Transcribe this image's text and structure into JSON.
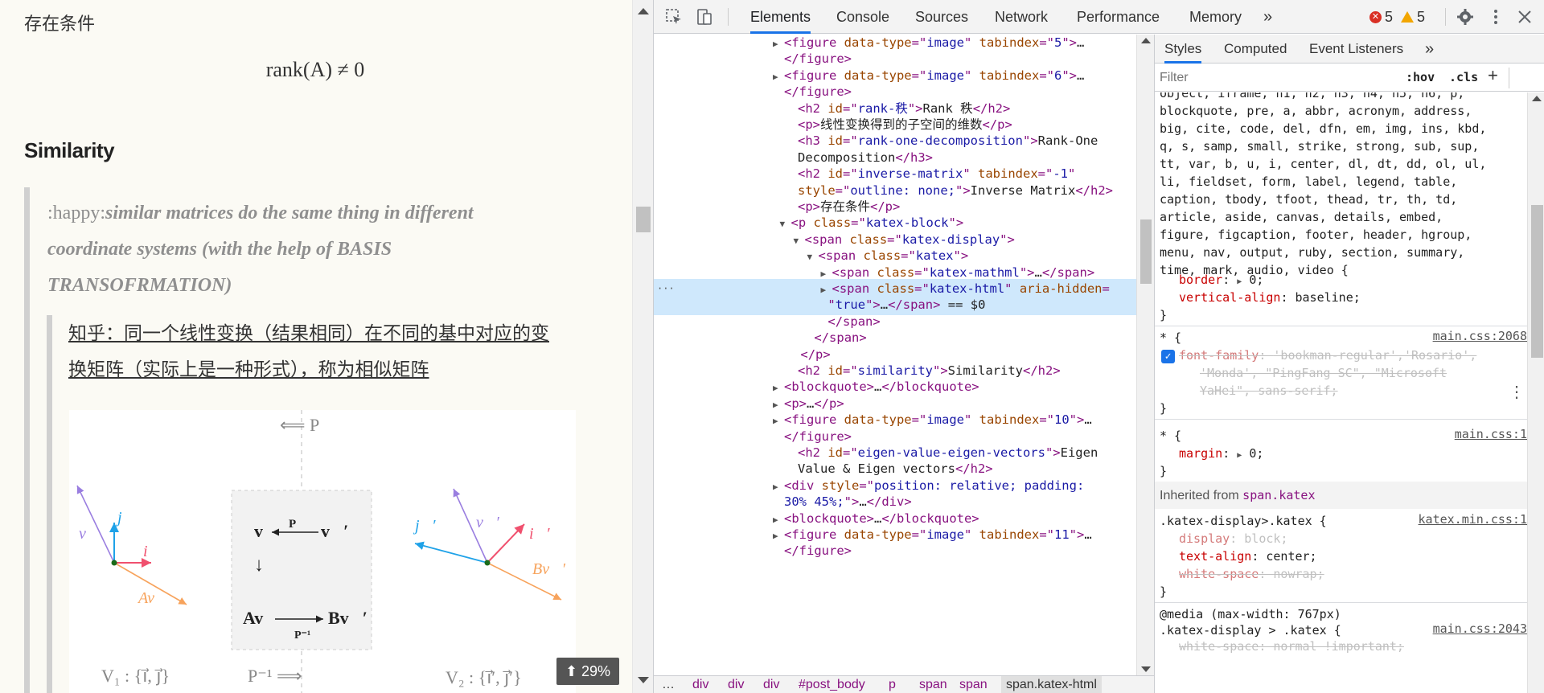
{
  "page": {
    "condition_label": "存在条件",
    "rank_formula": "rank(A) ≠ 0",
    "similarity_heading": "Similarity",
    "quote_prefix": ":happy:",
    "quote_text": "similar matrices do the same thing in different coordinate systems (with the help of BASIS TRANSOFRMATION)",
    "zhihu_quote": "知乎：同一个线性变换（结果相同）在不同的基中对应的变换矩阵（实际上是一种形式），称为相似矩阵",
    "scroll_percent": "29%",
    "figure": {
      "top_arrow": "⟸ P",
      "bottom_arrow": "P⁻¹ ⟹",
      "left_basis": "V₁ : {i⃗, j⃗}",
      "right_basis": "V₂ : {i⃗′, j⃗′}",
      "labels": {
        "v": "v⃗",
        "j": "j⃗",
        "i": "i⃗",
        "Av": "Av⃗",
        "jp": "j⃗′",
        "vp": "v⃗′",
        "ip": "i⃗′",
        "Bvp": "Bv⃗′",
        "box_v": "v⃗",
        "box_vp": "v⃗′",
        "box_P": "P",
        "box_Av": "Av⃗",
        "box_Bvp": "Bv⃗′",
        "box_Pinv": "P⁻¹",
        "box_down": "↓"
      },
      "colors": {
        "v": "#9a7ee0",
        "j": "#1fa2e8",
        "i": "#f0506e",
        "Av": "#f7a35c"
      }
    }
  },
  "devtools": {
    "tabs": [
      "Elements",
      "Console",
      "Sources",
      "Network",
      "Performance",
      "Memory"
    ],
    "more_tabs": "»",
    "errors": "5",
    "warnings": "5",
    "elements_lines": [
      {
        "indent": 0,
        "tri": "▶",
        "html": [
          [
            "tag",
            "<figure "
          ],
          [
            "attr",
            "data-type"
          ],
          [
            "tag",
            "=\""
          ],
          [
            "val",
            "image"
          ],
          [
            "tag",
            "\" "
          ],
          [
            "attr",
            "tabindex"
          ],
          [
            "tag",
            "=\""
          ],
          [
            "val",
            "5"
          ],
          [
            "tag",
            "\">"
          ],
          [
            "txt",
            "…"
          ]
        ]
      },
      {
        "indent": 0,
        "tri": "",
        "html": [
          [
            "tag",
            "</figure>"
          ]
        ]
      },
      {
        "indent": 0,
        "tri": "▶",
        "html": [
          [
            "tag",
            "<figure "
          ],
          [
            "attr",
            "data-type"
          ],
          [
            "tag",
            "=\""
          ],
          [
            "val",
            "image"
          ],
          [
            "tag",
            "\" "
          ],
          [
            "attr",
            "tabindex"
          ],
          [
            "tag",
            "=\""
          ],
          [
            "val",
            "6"
          ],
          [
            "tag",
            "\">"
          ],
          [
            "txt",
            "…"
          ]
        ]
      },
      {
        "indent": 0,
        "tri": "",
        "html": [
          [
            "tag",
            "</figure>"
          ]
        ]
      },
      {
        "indent": 1,
        "tri": "",
        "html": [
          [
            "tag",
            "<h2 "
          ],
          [
            "attr",
            "id"
          ],
          [
            "tag",
            "=\""
          ],
          [
            "val",
            "rank-秩"
          ],
          [
            "tag",
            "\">"
          ],
          [
            "txt",
            "Rank 秩"
          ],
          [
            "tag",
            "</h2>"
          ]
        ]
      },
      {
        "indent": 1,
        "tri": "",
        "html": [
          [
            "tag",
            "<p>"
          ],
          [
            "txt",
            "线性变换得到的子空间的维数"
          ],
          [
            "tag",
            "</p>"
          ]
        ]
      },
      {
        "indent": 1,
        "tri": "",
        "html": [
          [
            "tag",
            "<h3 "
          ],
          [
            "attr",
            "id"
          ],
          [
            "tag",
            "=\""
          ],
          [
            "val",
            "rank-one-decomposition"
          ],
          [
            "tag",
            "\">"
          ],
          [
            "txt",
            "Rank-One"
          ]
        ]
      },
      {
        "indent": 1,
        "tri": "",
        "html": [
          [
            "txt",
            "Decomposition"
          ],
          [
            "tag",
            "</h3>"
          ]
        ]
      },
      {
        "indent": 1,
        "tri": "",
        "html": [
          [
            "tag",
            "<h2 "
          ],
          [
            "attr",
            "id"
          ],
          [
            "tag",
            "=\""
          ],
          [
            "val",
            "inverse-matrix"
          ],
          [
            "tag",
            "\" "
          ],
          [
            "attr",
            "tabindex"
          ],
          [
            "tag",
            "=\""
          ],
          [
            "val",
            "-1"
          ],
          [
            "tag",
            "\""
          ]
        ]
      },
      {
        "indent": 1,
        "tri": "",
        "html": [
          [
            "attr",
            "style"
          ],
          [
            "tag",
            "=\""
          ],
          [
            "val",
            "outline: none;"
          ],
          [
            "tag",
            "\">"
          ],
          [
            "txt",
            "Inverse Matrix"
          ],
          [
            "tag",
            "</h2>"
          ]
        ]
      },
      {
        "indent": 1,
        "tri": "",
        "html": [
          [
            "tag",
            "<p>"
          ],
          [
            "txt",
            "存在条件"
          ],
          [
            "tag",
            "</p>"
          ]
        ]
      },
      {
        "indent": 0.5,
        "tri": "▼",
        "html": [
          [
            "tag",
            "<p "
          ],
          [
            "attr",
            "class"
          ],
          [
            "tag",
            "=\""
          ],
          [
            "val",
            "katex-block"
          ],
          [
            "tag",
            "\">"
          ]
        ]
      },
      {
        "indent": 1.5,
        "tri": "▼",
        "html": [
          [
            "tag",
            "<span "
          ],
          [
            "attr",
            "class"
          ],
          [
            "tag",
            "=\""
          ],
          [
            "val",
            "katex-display"
          ],
          [
            "tag",
            "\">"
          ]
        ]
      },
      {
        "indent": 2.5,
        "tri": "▼",
        "html": [
          [
            "tag",
            "<span "
          ],
          [
            "attr",
            "class"
          ],
          [
            "tag",
            "=\""
          ],
          [
            "val",
            "katex"
          ],
          [
            "tag",
            "\">"
          ]
        ]
      },
      {
        "indent": 3.5,
        "tri": "▶",
        "html": [
          [
            "tag",
            "<span "
          ],
          [
            "attr",
            "class"
          ],
          [
            "tag",
            "=\""
          ],
          [
            "val",
            "katex-mathml"
          ],
          [
            "tag",
            "\">"
          ],
          [
            "txt",
            "…"
          ],
          [
            "tag",
            "</span>"
          ]
        ]
      },
      {
        "indent": 3.5,
        "tri": "▶",
        "sel": true,
        "html": [
          [
            "tag",
            "<span "
          ],
          [
            "attr",
            "class"
          ],
          [
            "tag",
            "=\""
          ],
          [
            "val",
            "katex-html"
          ],
          [
            "tag",
            "\" "
          ],
          [
            "attr",
            "aria-hidden"
          ],
          [
            "tag",
            "="
          ]
        ]
      },
      {
        "indent": 3.2,
        "tri": "",
        "sel": true,
        "html": [
          [
            "tag",
            "\""
          ],
          [
            "val",
            "true"
          ],
          [
            "tag",
            "\">"
          ],
          [
            "txt",
            "…"
          ],
          [
            "tag",
            "</span>"
          ],
          [
            "txt",
            " == $0"
          ]
        ]
      },
      {
        "indent": 3.2,
        "tri": "",
        "html": [
          [
            "tag",
            "</span>"
          ]
        ]
      },
      {
        "indent": 2.2,
        "tri": "",
        "html": [
          [
            "tag",
            "</span>"
          ]
        ]
      },
      {
        "indent": 1.2,
        "tri": "",
        "html": [
          [
            "tag",
            "</p>"
          ]
        ]
      },
      {
        "indent": 1,
        "tri": "",
        "html": [
          [
            "tag",
            "<h2 "
          ],
          [
            "attr",
            "id"
          ],
          [
            "tag",
            "=\""
          ],
          [
            "val",
            "similarity"
          ],
          [
            "tag",
            "\">"
          ],
          [
            "txt",
            "Similarity"
          ],
          [
            "tag",
            "</h2>"
          ]
        ]
      },
      {
        "indent": 0,
        "tri": "▶",
        "html": [
          [
            "tag",
            "<blockquote>"
          ],
          [
            "txt",
            "…"
          ],
          [
            "tag",
            "</blockquote>"
          ]
        ]
      },
      {
        "indent": 0,
        "tri": "▶",
        "html": [
          [
            "tag",
            "<p>"
          ],
          [
            "txt",
            "…"
          ],
          [
            "tag",
            "</p>"
          ]
        ]
      },
      {
        "indent": 0,
        "tri": "▶",
        "html": [
          [
            "tag",
            "<figure "
          ],
          [
            "attr",
            "data-type"
          ],
          [
            "tag",
            "=\""
          ],
          [
            "val",
            "image"
          ],
          [
            "tag",
            "\" "
          ],
          [
            "attr",
            "tabindex"
          ],
          [
            "tag",
            "=\""
          ],
          [
            "val",
            "10"
          ],
          [
            "tag",
            "\">"
          ],
          [
            "txt",
            "…"
          ]
        ]
      },
      {
        "indent": 0,
        "tri": "",
        "html": [
          [
            "tag",
            "</figure>"
          ]
        ]
      },
      {
        "indent": 1,
        "tri": "",
        "html": [
          [
            "tag",
            "<h2 "
          ],
          [
            "attr",
            "id"
          ],
          [
            "tag",
            "=\""
          ],
          [
            "val",
            "eigen-value-eigen-vectors"
          ],
          [
            "tag",
            "\">"
          ],
          [
            "txt",
            "Eigen"
          ]
        ]
      },
      {
        "indent": 1,
        "tri": "",
        "html": [
          [
            "txt",
            "Value & Eigen vectors"
          ],
          [
            "tag",
            "</h2>"
          ]
        ]
      },
      {
        "indent": 0,
        "tri": "▶",
        "html": [
          [
            "tag",
            "<div "
          ],
          [
            "attr",
            "style"
          ],
          [
            "tag",
            "=\""
          ],
          [
            "val",
            "position: relative; padding:"
          ]
        ]
      },
      {
        "indent": 0,
        "tri": "",
        "html": [
          [
            "val",
            "30% 45%;"
          ],
          [
            "tag",
            "\">"
          ],
          [
            "txt",
            "…"
          ],
          [
            "tag",
            "</div>"
          ]
        ]
      },
      {
        "indent": 0,
        "tri": "▶",
        "html": [
          [
            "tag",
            "<blockquote>"
          ],
          [
            "txt",
            "…"
          ],
          [
            "tag",
            "</blockquote>"
          ]
        ]
      },
      {
        "indent": 0,
        "tri": "▶",
        "html": [
          [
            "tag",
            "<figure "
          ],
          [
            "attr",
            "data-type"
          ],
          [
            "tag",
            "=\""
          ],
          [
            "val",
            "image"
          ],
          [
            "tag",
            "\" "
          ],
          [
            "attr",
            "tabindex"
          ],
          [
            "tag",
            "=\""
          ],
          [
            "val",
            "11"
          ],
          [
            "tag",
            "\">"
          ],
          [
            "txt",
            "…"
          ]
        ]
      },
      {
        "indent": 0,
        "tri": "",
        "html": [
          [
            "tag",
            "</figure>"
          ]
        ]
      }
    ],
    "breadcrumbs": [
      "…",
      "div",
      "div",
      "div",
      "#post_body",
      "p",
      "span",
      "span",
      "span.katex-html"
    ],
    "styles_tabs": [
      "Styles",
      "Computed",
      "Event Listeners"
    ],
    "styles_more": "»",
    "filter_placeholder": "Filter",
    "hov": ":hov",
    "cls": ".cls",
    "rules": {
      "reset_selector_lines": [
        "object, iframe, h1, h2, h3, h4, h5, h6, p,",
        "blockquote, pre, a, abbr, acronym, address,",
        "big, cite, code, del, dfn, em, img, ins, kbd,",
        "q, s, samp, small, strike, strong, sub, sup,",
        "tt, var, b, u, i, center, dl, dt, dd, ol, ul,",
        "li, fieldset, form, label, legend, table,",
        "caption, tbody, tfoot, thead, tr, th, td,",
        "article, aside, canvas, details, embed,",
        "figure, figcaption, footer, header, hgroup,",
        "menu, nav, output, ruby, section, summary,",
        "time, mark, audio, video {"
      ],
      "border_prop": "border",
      "border_val": "0;",
      "valign_prop": "vertical-align",
      "valign_val": "baseline;",
      "close": "}",
      "star_selector": "* {",
      "src_2068": "main.css:2068",
      "ff_prop": "font-family",
      "ff_val1": "'bookman-regular','Rosario',",
      "ff_val2": "'Monda', \"PingFang SC\", \"Microsoft",
      "ff_val3": "YaHei\", sans-serif;",
      "src_1": "main.css:1",
      "margin_prop": "margin",
      "margin_val": "0;",
      "inherited_label": "Inherited from",
      "inherited_from": "span.katex",
      "kd_selector": ".katex-display>.katex {",
      "src_katex": "katex.min.css:1",
      "display_prop": "display",
      "display_val": "block;",
      "ta_prop": "text-align",
      "ta_val": "center;",
      "ws_prop": "white-space",
      "ws_val": "nowrap;",
      "media_query": "@media (max-width: 767px)",
      "kd2_selector": ".katex-display > .katex {",
      "src_2043": "main.css:2043",
      "ws2_line": "white-space: normal !important;"
    }
  }
}
